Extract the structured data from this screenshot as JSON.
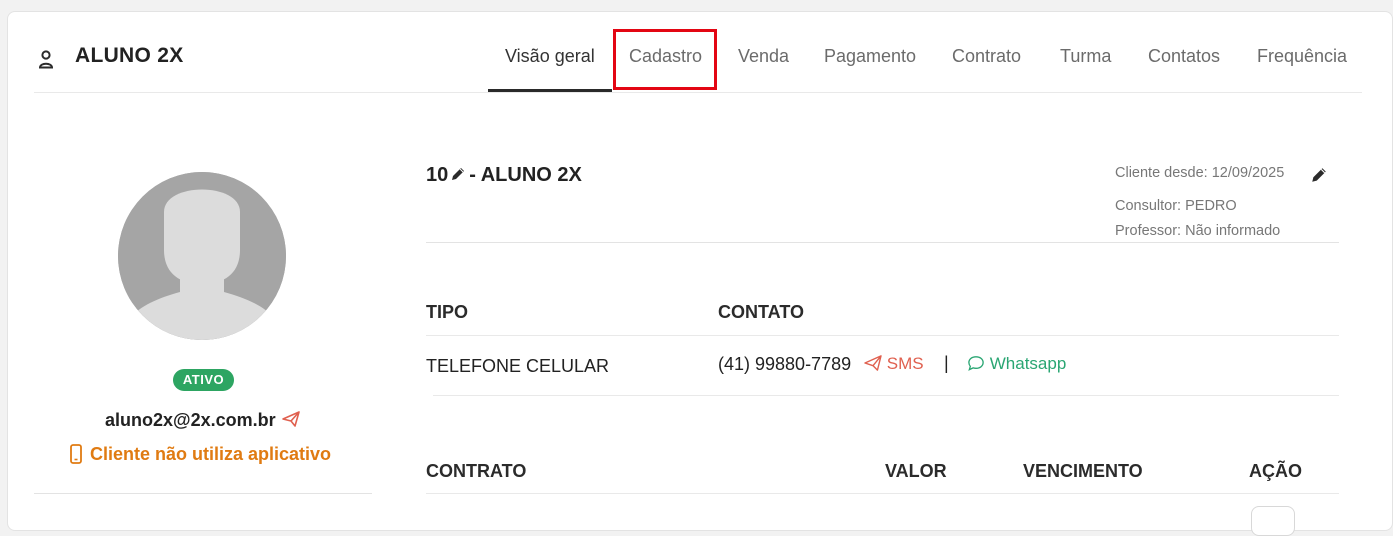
{
  "header": {
    "title": "ALUNO 2X",
    "tabs": [
      {
        "label": "Visão geral",
        "active": true
      },
      {
        "label": "Cadastro",
        "active": false
      },
      {
        "label": "Venda",
        "active": false
      },
      {
        "label": "Pagamento",
        "active": false
      },
      {
        "label": "Contrato",
        "active": false
      },
      {
        "label": "Turma",
        "active": false
      },
      {
        "label": "Contatos",
        "active": false
      },
      {
        "label": "Frequência",
        "active": false
      }
    ]
  },
  "profile": {
    "status": "ATIVO",
    "email": "aluno2x@2x.com.br",
    "app_warning": "Cliente não utiliza aplicativo"
  },
  "client": {
    "code": "10",
    "name_suffix": "- ALUNO 2X",
    "since": "Cliente desde: 12/09/2025",
    "consultant": "Consultor: PEDRO",
    "teacher": "Professor: Não informado"
  },
  "contacts": {
    "headers": {
      "type": "TIPO",
      "contact": "CONTATO"
    },
    "rows": [
      {
        "type": "TELEFONE CELULAR",
        "value": "(41) 99880-7789",
        "sms_label": "SMS",
        "separator": "|",
        "whatsapp_label": "Whatsapp"
      }
    ]
  },
  "contracts": {
    "headers": {
      "contract": "CONTRATO",
      "value": "VALOR",
      "due": "VENCIMENTO",
      "action": "AÇÃO"
    }
  },
  "colors": {
    "active_badge": "#2da562",
    "warning": "#e07b12",
    "sms": "#e0604f",
    "whatsapp": "#2aa673",
    "highlight": "#e30613"
  }
}
